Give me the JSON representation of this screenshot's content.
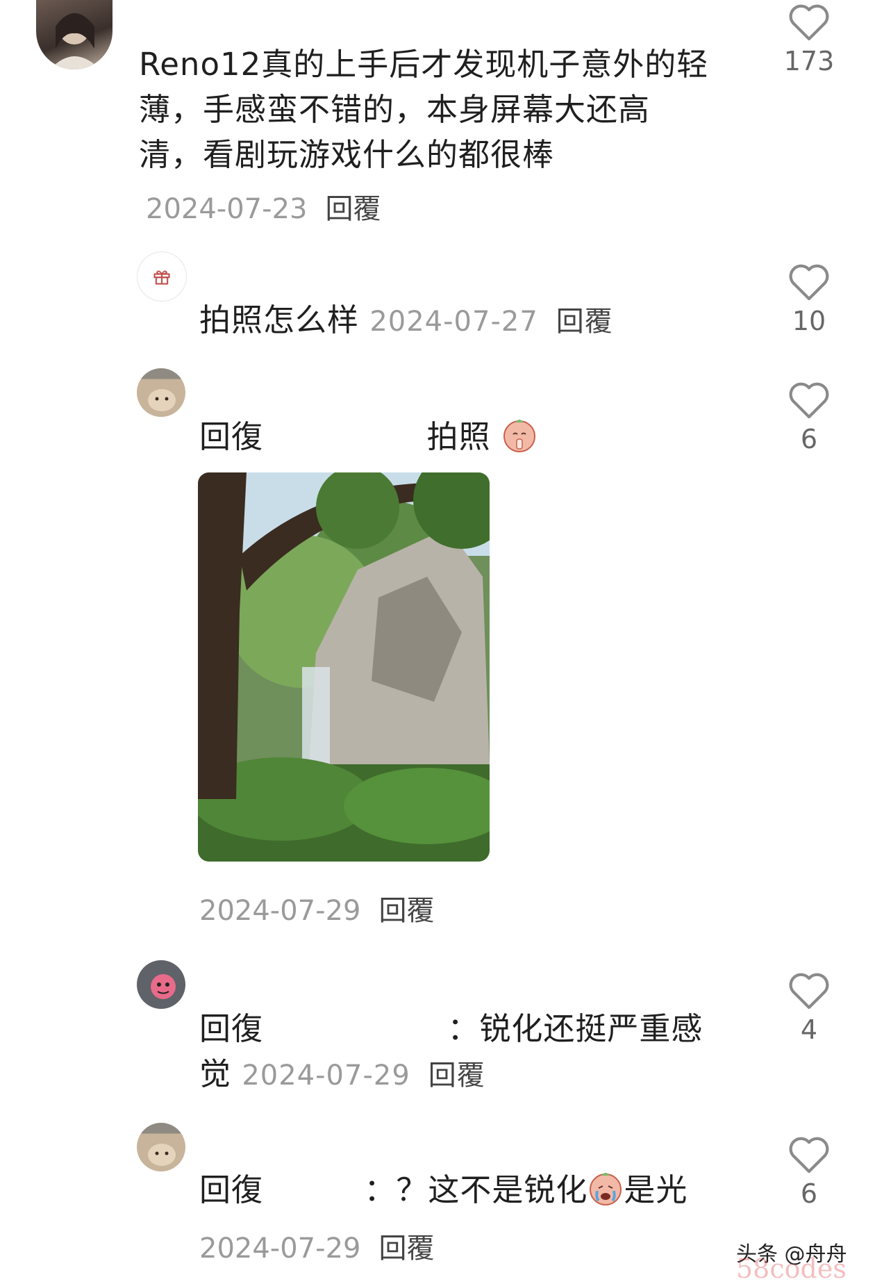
{
  "comments": [
    {
      "text": "Reno12真的上手后才发现机子意外的轻薄，手感蛮不错的，本身屏幕大还高清，看剧玩游戏什么的都很棒",
      "line1": "Reno12真的上手后才发现机子意外的轻",
      "line2": "薄，手感蛮不错的，本身屏幕大还高",
      "line3": "清，看剧玩游戏什么的都很棒",
      "date": "2024-07-23",
      "reply_label": "回覆",
      "likes": "173"
    },
    {
      "text": "拍照怎么样",
      "date": "2024-07-27",
      "reply_label": "回覆",
      "likes": "10"
    },
    {
      "reply_prefix": "回復",
      "text": "拍照",
      "date": "2024-07-29",
      "reply_label": "回覆",
      "likes": "6"
    },
    {
      "reply_prefix": "回復",
      "text_line1": "：锐化还挺严重感",
      "text_line2": "觉",
      "date": "2024-07-29",
      "reply_label": "回覆",
      "likes": "4"
    },
    {
      "reply_prefix": "回復",
      "text_a": "：？这不是锐化",
      "text_b": "是光",
      "date": "2024-07-29",
      "reply_label": "回覆",
      "likes": "6"
    }
  ],
  "icons": {
    "like": "heart-outline-icon",
    "gift": "gift-icon",
    "emoji_pray": "praying-emoji-icon",
    "emoji_cry": "crying-emoji-icon"
  },
  "watermark": {
    "source": "头条 @舟舟",
    "site": "58codes"
  },
  "colors": {
    "text": "#1f1f1f",
    "meta": "#9a9a9a",
    "icon": "#8a8a8a"
  }
}
